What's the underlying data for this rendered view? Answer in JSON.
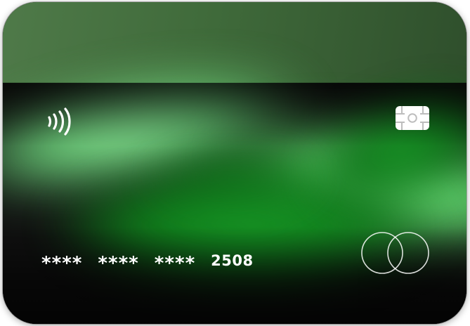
{
  "card": {
    "number_groups": [
      "****",
      "****",
      "****"
    ],
    "last4": "2508"
  },
  "icons": {
    "contactless": "contactless-icon",
    "chip": "chip-icon",
    "brand": "brand-rings-icon"
  },
  "colors": {
    "top": "#4f7a49",
    "glow_light": "#9cf6a6",
    "glow_mid": "#5fe06e",
    "glow_dark": "#0f7f1b",
    "body": "#101010",
    "text": "#ffffff"
  }
}
